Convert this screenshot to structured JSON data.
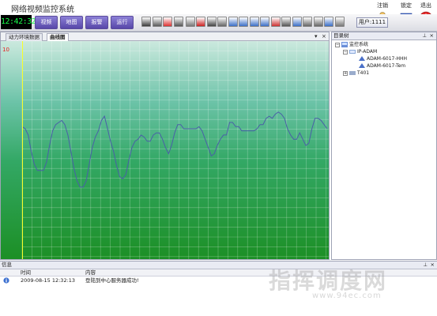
{
  "app": {
    "title": "网络视频监控系统"
  },
  "topright": {
    "logout": "注销",
    "lock": "锁定",
    "exit": "退出"
  },
  "toolbar": {
    "clock": "12:42:32",
    "nav": [
      "视频",
      "地图",
      "报警",
      "运行"
    ],
    "user_label": "用户:1111",
    "tool_icons": [
      "grid-icon",
      "camera-icon",
      "record-icon",
      "monitor-icon",
      "document-icon",
      "help-icon",
      "alarm-icon",
      "tools-icon",
      "window-icon",
      "window-icon",
      "window-icon",
      "window-icon",
      "flag-icon",
      "pen-icon",
      "window-icon",
      "device-icon",
      "device-icon",
      "image-icon",
      "settings-icon"
    ]
  },
  "left_panel": {
    "tabs": [
      "动力环境数据",
      "曲线图"
    ],
    "active_tab": "曲线图",
    "pin": "▾",
    "close": "×"
  },
  "chart_data": {
    "type": "line",
    "title": "",
    "xlabel": "",
    "ylabel": "",
    "y_tick_labels": [
      "10"
    ],
    "grid": true,
    "series": [
      {
        "color": "#4a5fa8",
        "x": [
          0,
          1,
          2,
          3,
          4,
          5,
          6,
          7,
          8,
          9,
          10,
          11,
          12,
          13,
          14,
          15,
          16,
          17,
          18,
          19,
          20,
          21,
          22,
          23,
          24,
          25,
          26,
          27,
          28,
          29,
          30,
          31,
          32,
          33,
          34,
          35,
          36,
          37,
          38,
          39,
          40,
          41,
          42,
          43,
          44,
          45,
          46,
          47,
          48,
          49,
          50,
          51,
          52,
          53,
          54,
          55,
          56,
          57,
          58,
          59,
          60,
          61,
          62,
          63,
          64,
          65,
          66,
          67,
          68,
          69,
          70,
          71,
          72,
          73,
          74,
          75,
          76,
          77,
          78,
          79,
          80,
          81,
          82,
          83,
          84,
          85,
          86,
          87,
          88,
          89,
          90,
          91,
          92,
          93,
          94,
          95,
          96,
          97,
          98,
          99,
          100
        ],
        "values": [
          6.2,
          6.1,
          5.8,
          5.0,
          4.4,
          4.1,
          4.1,
          4.1,
          4.5,
          5.3,
          6.0,
          6.3,
          6.4,
          6.5,
          6.3,
          5.8,
          5.0,
          4.2,
          3.6,
          3.3,
          3.3,
          3.6,
          4.4,
          5.2,
          5.7,
          6.0,
          6.5,
          6.7,
          6.1,
          5.5,
          5.0,
          4.3,
          3.8,
          3.7,
          3.9,
          4.6,
          5.2,
          5.5,
          5.6,
          5.8,
          5.7,
          5.5,
          5.5,
          5.8,
          5.9,
          5.9,
          5.6,
          5.2,
          4.9,
          5.3,
          5.9,
          6.3,
          6.3,
          6.1,
          6.1,
          6.1,
          6.1,
          6.1,
          6.2,
          6.0,
          5.6,
          5.2,
          4.8,
          4.9,
          5.3,
          5.6,
          5.8,
          5.8,
          6.4,
          6.4,
          6.2,
          6.2,
          6.0,
          6.0,
          6.0,
          6.0,
          6.0,
          6.1,
          6.3,
          6.3,
          6.6,
          6.7,
          6.6,
          6.8,
          6.9,
          6.8,
          6.6,
          6.1,
          5.8,
          5.6,
          5.6,
          5.9,
          5.6,
          5.3,
          5.4,
          6.1,
          6.6,
          6.6,
          6.5,
          6.3,
          6.1
        ]
      }
    ],
    "ylim": [
      0,
      10
    ],
    "xlim": [
      0,
      100
    ]
  },
  "right_panel": {
    "title": "目录树",
    "pin": "⊥",
    "close": "×",
    "tree": [
      {
        "label": "监控系统",
        "expander": "−"
      },
      {
        "label": "IP-ADAM",
        "expander": "−"
      },
      {
        "label": "ADAM-6017-HHH",
        "expander": ""
      },
      {
        "label": "ADAM-6017-Tem",
        "expander": ""
      },
      {
        "label": "T401",
        "expander": "+"
      }
    ]
  },
  "bottom_panel": {
    "title": "信息",
    "pin": "⊥",
    "close": "×",
    "columns": [
      "时间",
      "内容"
    ],
    "rows": [
      {
        "time": "2009-08-15 12:32:13",
        "content": "登陆到中心服务器成功!"
      }
    ]
  },
  "watermark": {
    "text": "指挥调度网",
    "url": "www.94ec.com"
  },
  "colors": {
    "chart_line": "#4a5fa8",
    "y_axis": "#f7ff2a",
    "y_tick": "#e81e1e",
    "clock_text": "#19ff4a",
    "nav_button": "#6f62c2"
  }
}
